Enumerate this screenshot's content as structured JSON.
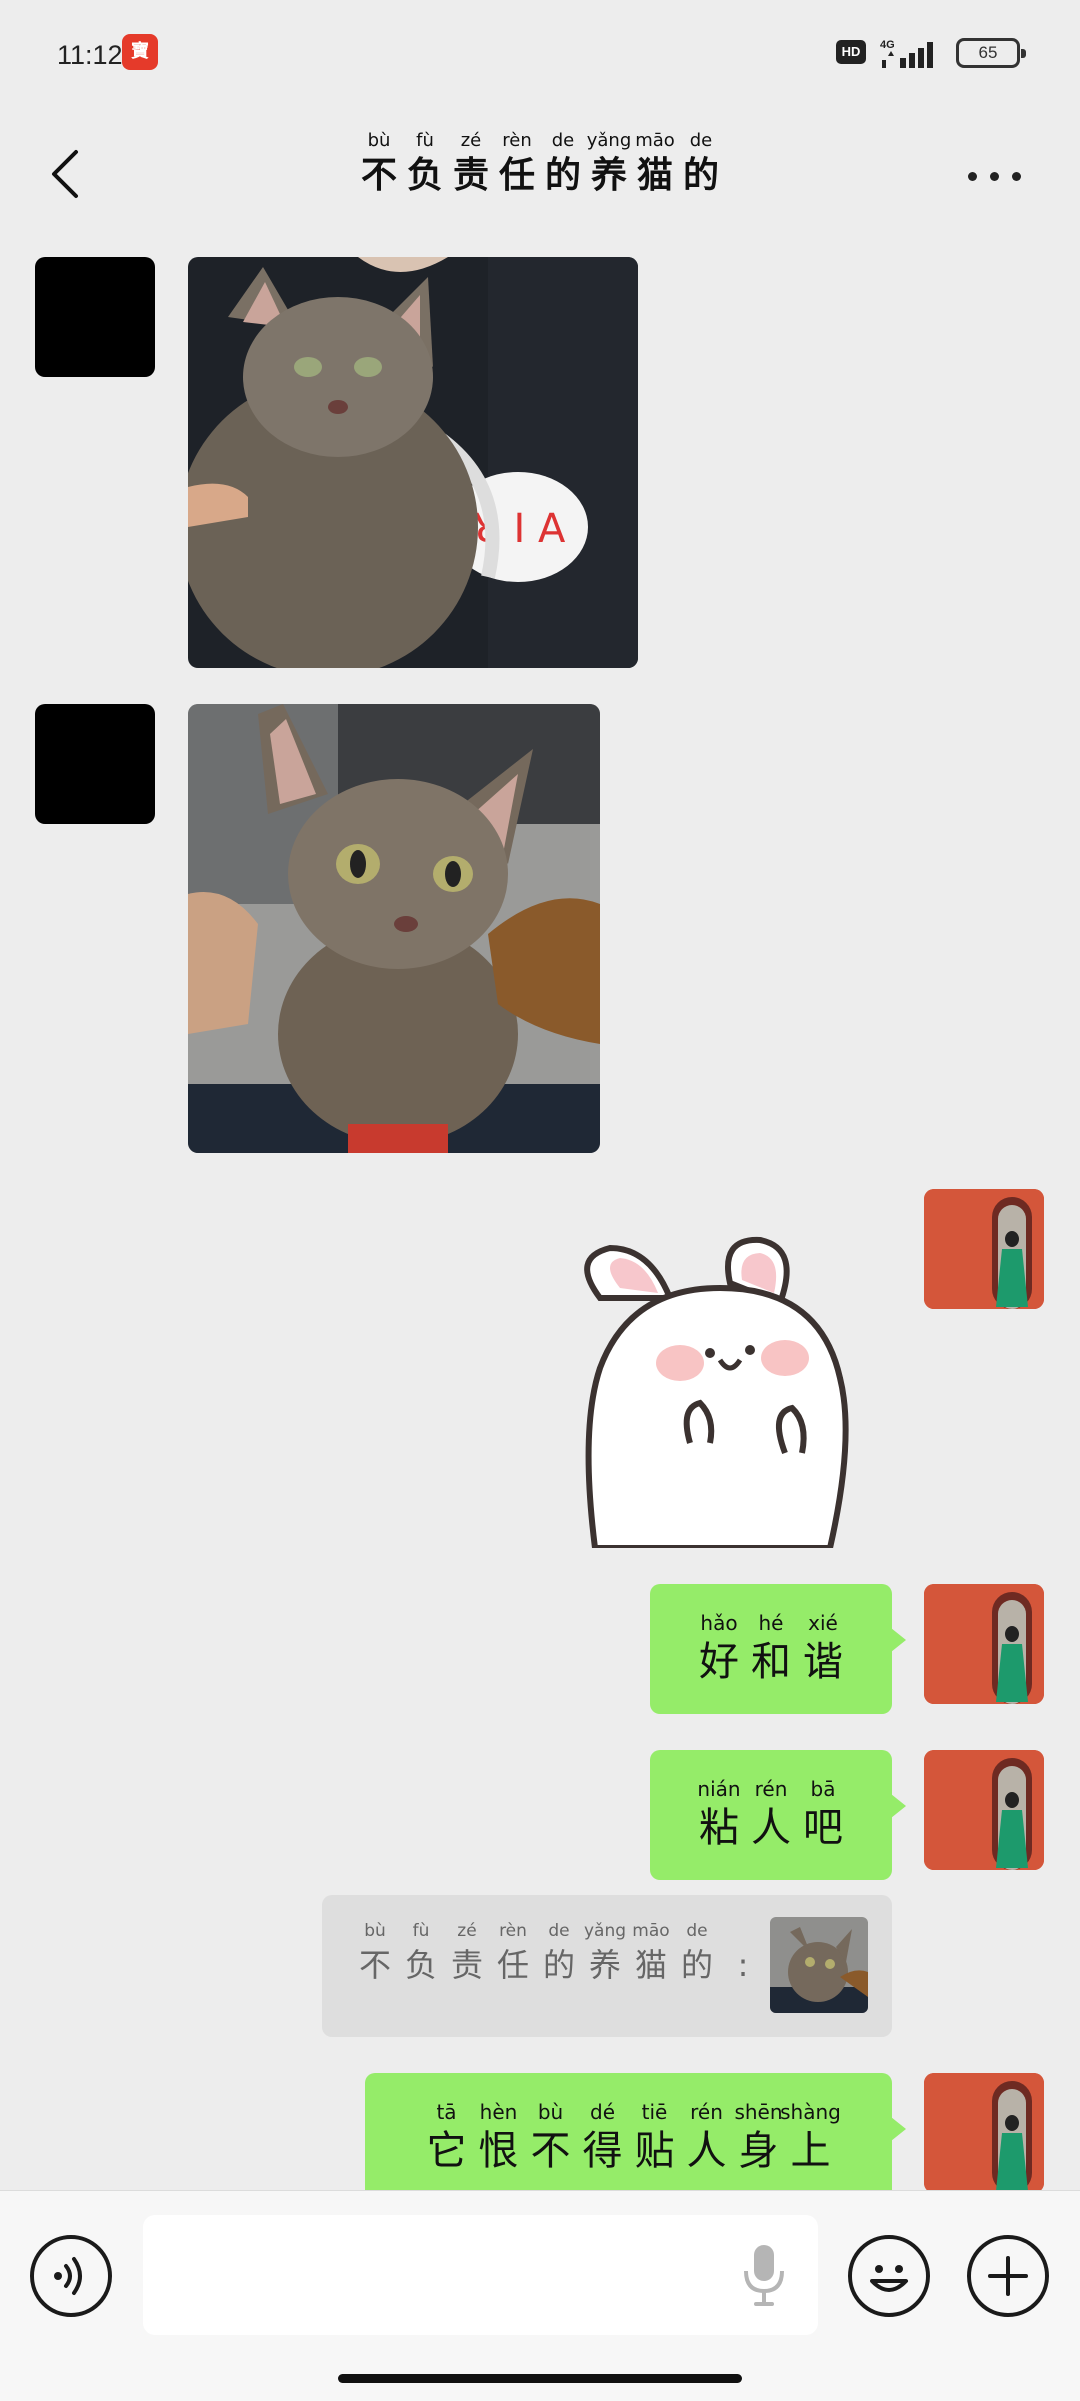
{
  "status_bar": {
    "time": "11:12",
    "app_icon_glyph": "寶",
    "hd_label": "HD",
    "network": "4G",
    "battery": "65"
  },
  "header": {
    "title": [
      {
        "py": "bù",
        "hz": "不"
      },
      {
        "py": "fù",
        "hz": "负"
      },
      {
        "py": "zé",
        "hz": "责"
      },
      {
        "py": "rèn",
        "hz": "任"
      },
      {
        "py": "de",
        "hz": "的"
      },
      {
        "py": "yǎng",
        "hz": "养"
      },
      {
        "py": "māo",
        "hz": "猫"
      },
      {
        "py": "de",
        "hz": "的"
      }
    ],
    "back_icon": "chevron-left-icon",
    "more_icon": "more-dots-icon"
  },
  "messages": [
    {
      "type": "image",
      "sender": "other",
      "content": "tabby cat held against black t-shirt"
    },
    {
      "type": "image",
      "sender": "other",
      "content": "tabby cat looking at camera"
    },
    {
      "type": "sticker",
      "sender": "me",
      "content": "white bunny sticker"
    },
    {
      "type": "text",
      "sender": "me",
      "chars": [
        {
          "py": "hǎo",
          "hz": "好"
        },
        {
          "py": "hé",
          "hz": "和"
        },
        {
          "py": "xié",
          "hz": "谐"
        }
      ]
    },
    {
      "type": "text",
      "sender": "me",
      "chars": [
        {
          "py": "nián",
          "hz": "粘"
        },
        {
          "py": "rén",
          "hz": "人"
        },
        {
          "py": "bā",
          "hz": "吧"
        }
      ]
    },
    {
      "type": "quote",
      "sender": "me",
      "chars": [
        {
          "py": "bù",
          "hz": "不"
        },
        {
          "py": "fù",
          "hz": "负"
        },
        {
          "py": "zé",
          "hz": "责"
        },
        {
          "py": "rèn",
          "hz": "任"
        },
        {
          "py": "de",
          "hz": "的"
        },
        {
          "py": "yǎng",
          "hz": "养"
        },
        {
          "py": "māo",
          "hz": "猫"
        },
        {
          "py": "de",
          "hz": "的"
        },
        {
          "py": "",
          "hz": ":"
        }
      ]
    },
    {
      "type": "text",
      "sender": "me",
      "chars": [
        {
          "py": "tā",
          "hz": "它"
        },
        {
          "py": "hèn",
          "hz": "恨"
        },
        {
          "py": "bù",
          "hz": "不"
        },
        {
          "py": "dé",
          "hz": "得"
        },
        {
          "py": "tiē",
          "hz": "贴"
        },
        {
          "py": "rén",
          "hz": "人"
        },
        {
          "py": "shēn",
          "hz": "身"
        },
        {
          "py": "shàng",
          "hz": "上"
        }
      ]
    }
  ],
  "input_bar": {
    "placeholder": "",
    "voice_icon": "voice-toggle-icon",
    "mic_icon": "microphone-icon",
    "emoji_icon": "emoji-icon",
    "plus_icon": "plus-icon"
  },
  "colors": {
    "background": "#ededed",
    "bubble_green": "#95ec69",
    "quote_gray": "#dedede"
  }
}
